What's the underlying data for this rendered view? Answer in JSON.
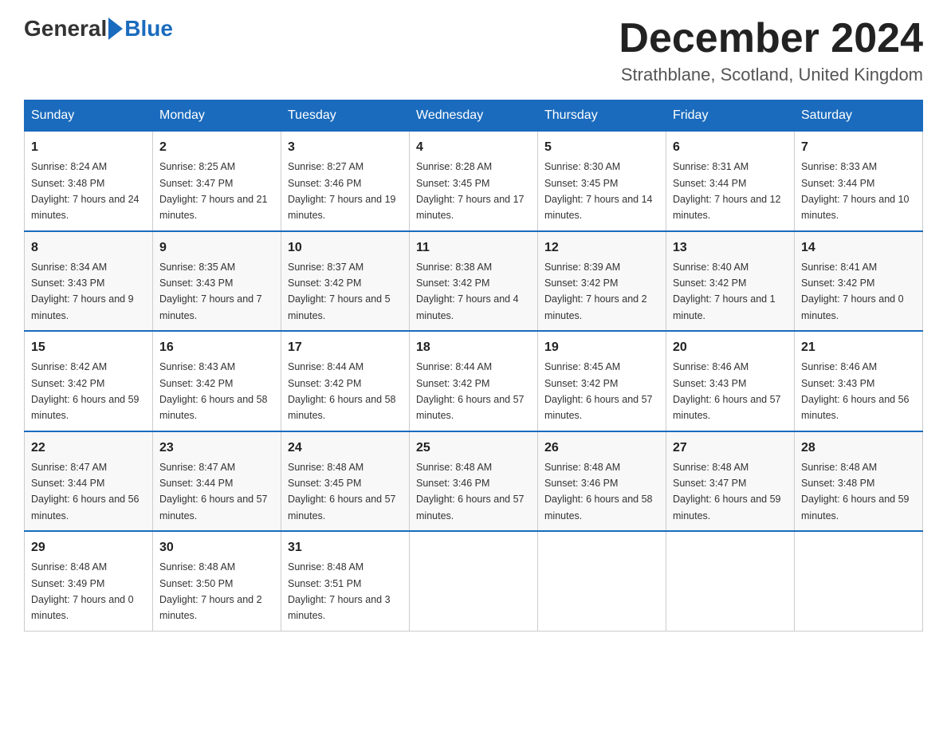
{
  "header": {
    "logo_general": "General",
    "logo_blue": "Blue",
    "month_title": "December 2024",
    "location": "Strathblane, Scotland, United Kingdom"
  },
  "weekdays": [
    "Sunday",
    "Monday",
    "Tuesday",
    "Wednesday",
    "Thursday",
    "Friday",
    "Saturday"
  ],
  "weeks": [
    [
      {
        "day": "1",
        "sunrise": "8:24 AM",
        "sunset": "3:48 PM",
        "daylight": "7 hours and 24 minutes."
      },
      {
        "day": "2",
        "sunrise": "8:25 AM",
        "sunset": "3:47 PM",
        "daylight": "7 hours and 21 minutes."
      },
      {
        "day": "3",
        "sunrise": "8:27 AM",
        "sunset": "3:46 PM",
        "daylight": "7 hours and 19 minutes."
      },
      {
        "day": "4",
        "sunrise": "8:28 AM",
        "sunset": "3:45 PM",
        "daylight": "7 hours and 17 minutes."
      },
      {
        "day": "5",
        "sunrise": "8:30 AM",
        "sunset": "3:45 PM",
        "daylight": "7 hours and 14 minutes."
      },
      {
        "day": "6",
        "sunrise": "8:31 AM",
        "sunset": "3:44 PM",
        "daylight": "7 hours and 12 minutes."
      },
      {
        "day": "7",
        "sunrise": "8:33 AM",
        "sunset": "3:44 PM",
        "daylight": "7 hours and 10 minutes."
      }
    ],
    [
      {
        "day": "8",
        "sunrise": "8:34 AM",
        "sunset": "3:43 PM",
        "daylight": "7 hours and 9 minutes."
      },
      {
        "day": "9",
        "sunrise": "8:35 AM",
        "sunset": "3:43 PM",
        "daylight": "7 hours and 7 minutes."
      },
      {
        "day": "10",
        "sunrise": "8:37 AM",
        "sunset": "3:42 PM",
        "daylight": "7 hours and 5 minutes."
      },
      {
        "day": "11",
        "sunrise": "8:38 AM",
        "sunset": "3:42 PM",
        "daylight": "7 hours and 4 minutes."
      },
      {
        "day": "12",
        "sunrise": "8:39 AM",
        "sunset": "3:42 PM",
        "daylight": "7 hours and 2 minutes."
      },
      {
        "day": "13",
        "sunrise": "8:40 AM",
        "sunset": "3:42 PM",
        "daylight": "7 hours and 1 minute."
      },
      {
        "day": "14",
        "sunrise": "8:41 AM",
        "sunset": "3:42 PM",
        "daylight": "7 hours and 0 minutes."
      }
    ],
    [
      {
        "day": "15",
        "sunrise": "8:42 AM",
        "sunset": "3:42 PM",
        "daylight": "6 hours and 59 minutes."
      },
      {
        "day": "16",
        "sunrise": "8:43 AM",
        "sunset": "3:42 PM",
        "daylight": "6 hours and 58 minutes."
      },
      {
        "day": "17",
        "sunrise": "8:44 AM",
        "sunset": "3:42 PM",
        "daylight": "6 hours and 58 minutes."
      },
      {
        "day": "18",
        "sunrise": "8:44 AM",
        "sunset": "3:42 PM",
        "daylight": "6 hours and 57 minutes."
      },
      {
        "day": "19",
        "sunrise": "8:45 AM",
        "sunset": "3:42 PM",
        "daylight": "6 hours and 57 minutes."
      },
      {
        "day": "20",
        "sunrise": "8:46 AM",
        "sunset": "3:43 PM",
        "daylight": "6 hours and 57 minutes."
      },
      {
        "day": "21",
        "sunrise": "8:46 AM",
        "sunset": "3:43 PM",
        "daylight": "6 hours and 56 minutes."
      }
    ],
    [
      {
        "day": "22",
        "sunrise": "8:47 AM",
        "sunset": "3:44 PM",
        "daylight": "6 hours and 56 minutes."
      },
      {
        "day": "23",
        "sunrise": "8:47 AM",
        "sunset": "3:44 PM",
        "daylight": "6 hours and 57 minutes."
      },
      {
        "day": "24",
        "sunrise": "8:48 AM",
        "sunset": "3:45 PM",
        "daylight": "6 hours and 57 minutes."
      },
      {
        "day": "25",
        "sunrise": "8:48 AM",
        "sunset": "3:46 PM",
        "daylight": "6 hours and 57 minutes."
      },
      {
        "day": "26",
        "sunrise": "8:48 AM",
        "sunset": "3:46 PM",
        "daylight": "6 hours and 58 minutes."
      },
      {
        "day": "27",
        "sunrise": "8:48 AM",
        "sunset": "3:47 PM",
        "daylight": "6 hours and 59 minutes."
      },
      {
        "day": "28",
        "sunrise": "8:48 AM",
        "sunset": "3:48 PM",
        "daylight": "6 hours and 59 minutes."
      }
    ],
    [
      {
        "day": "29",
        "sunrise": "8:48 AM",
        "sunset": "3:49 PM",
        "daylight": "7 hours and 0 minutes."
      },
      {
        "day": "30",
        "sunrise": "8:48 AM",
        "sunset": "3:50 PM",
        "daylight": "7 hours and 2 minutes."
      },
      {
        "day": "31",
        "sunrise": "8:48 AM",
        "sunset": "3:51 PM",
        "daylight": "7 hours and 3 minutes."
      },
      null,
      null,
      null,
      null
    ]
  ]
}
